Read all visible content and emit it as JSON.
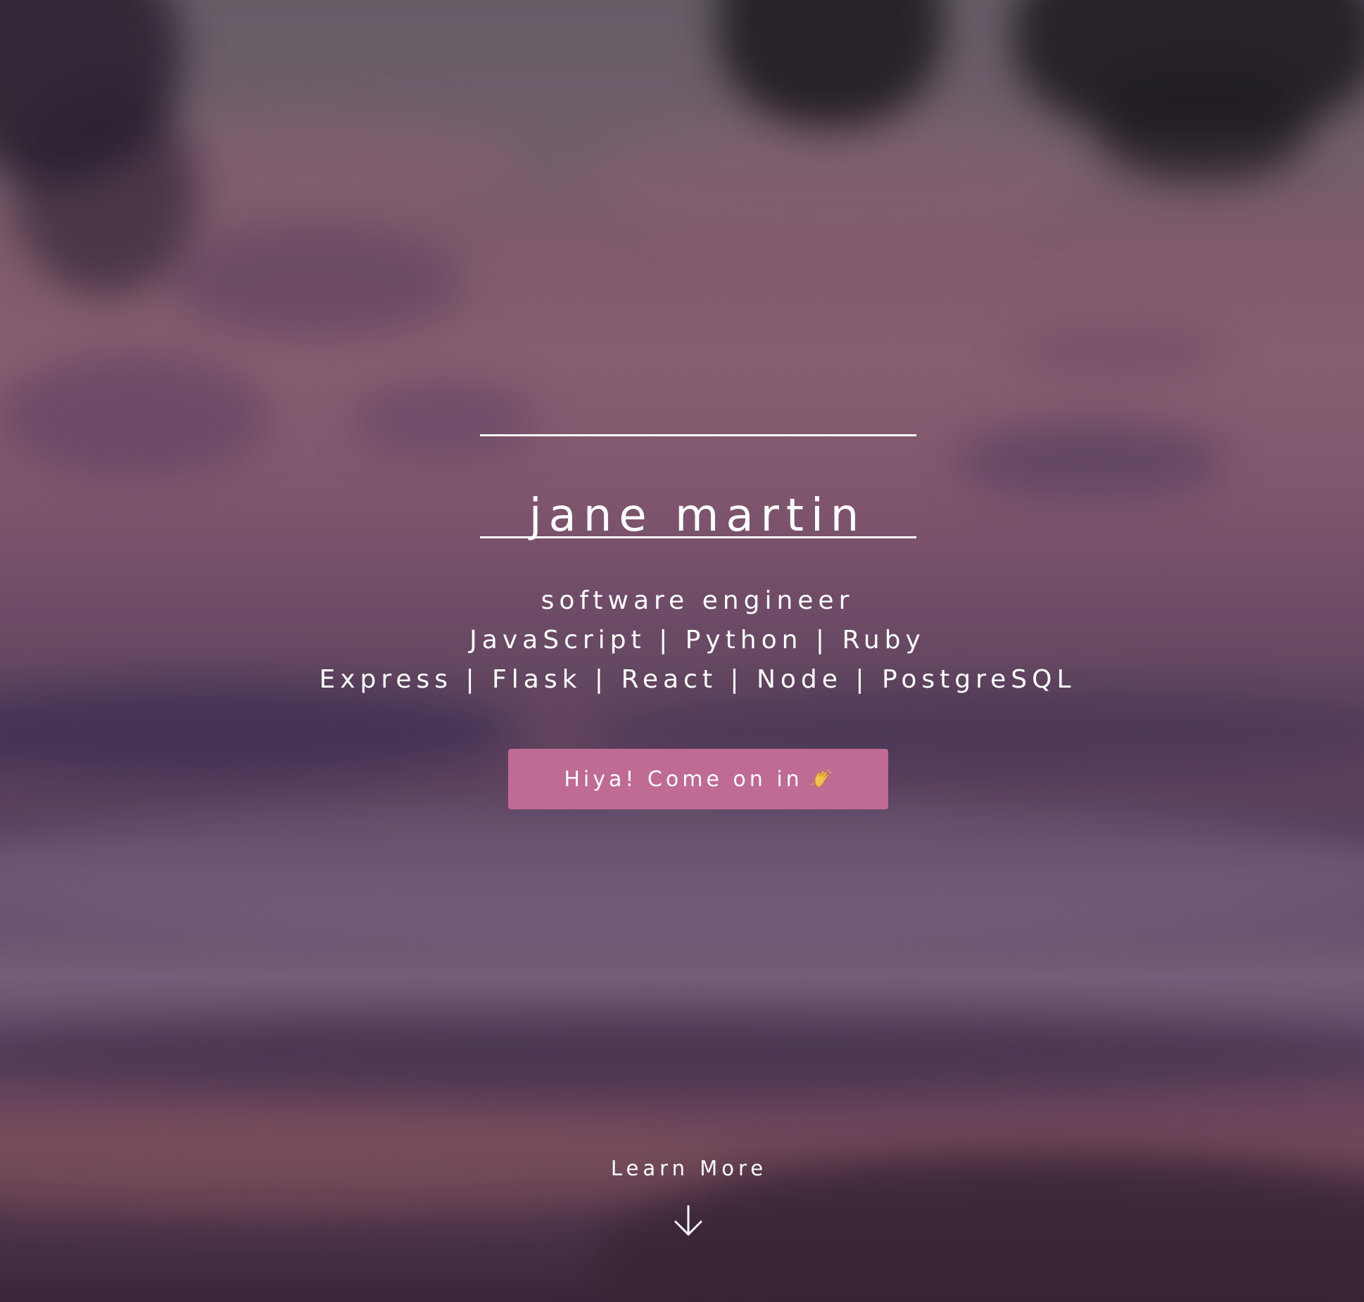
{
  "hero": {
    "name": "jane martin",
    "tagline": "software engineer",
    "languages": "JavaScript | Python | Ruby",
    "frameworks": "Express | Flask | React | Node | PostgreSQL"
  },
  "cta": {
    "label": "Hiya! Come on in",
    "icon": "waving-hand-icon",
    "color": "#bf6b93"
  },
  "learn_more": {
    "label": "Learn More",
    "icon": "arrow-down-icon"
  },
  "colors": {
    "text": "#ffffff",
    "accent": "#bf6b93"
  }
}
